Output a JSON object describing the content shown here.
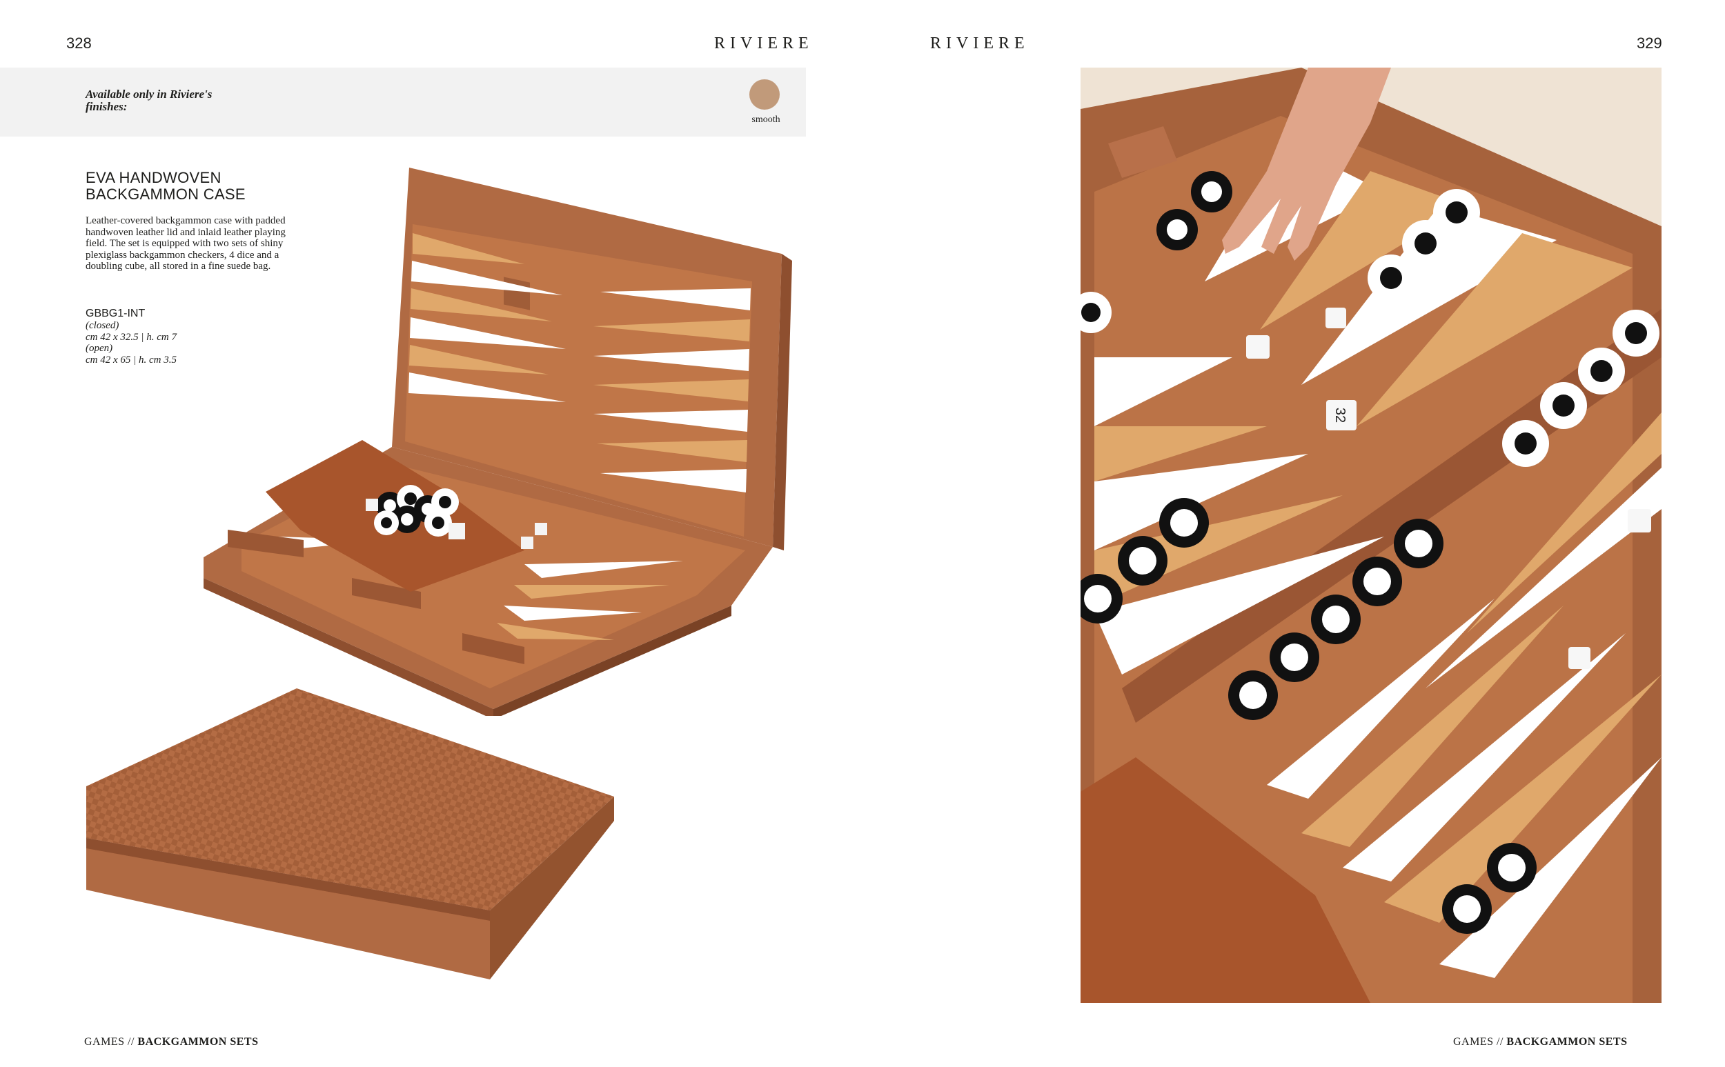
{
  "left_page": {
    "page_number": "328",
    "brand": "RIVIERE",
    "finishes": {
      "label": "Available only in Riviere's finishes:",
      "swatch_color": "#c19a7a",
      "swatch_label": "smooth"
    },
    "product": {
      "title": "EVA HANDWOVEN BACKGAMMON CASE",
      "description": "Leather-covered backgammon case with padded handwoven leather lid and inlaid leather playing field. The set is equipped with two sets of shiny plexiglass backgammon checkers, 4 dice and a doubling cube, all stored in a fine suede bag.",
      "code": "GBBG1-INT",
      "closed_label": "(closed)",
      "closed_dims": "cm 42 x 32.5 | h. cm 7",
      "open_label": "(open)",
      "open_dims": "cm 42 x 65 | h. cm 3.5"
    },
    "footer": {
      "category": "GAMES // ",
      "section": "BACKGAMMON SETS"
    }
  },
  "right_page": {
    "page_number": "329",
    "brand": "RIVIERE",
    "doubling_cube_text": "32",
    "footer": {
      "category": "GAMES // ",
      "section": "BACKGAMMON SETS"
    }
  },
  "colors": {
    "leather": "#b06a43",
    "leather_dark": "#8e4f2f",
    "tan": "#e0a86b",
    "white_point": "#ffffff",
    "suede": "#a8552c"
  }
}
